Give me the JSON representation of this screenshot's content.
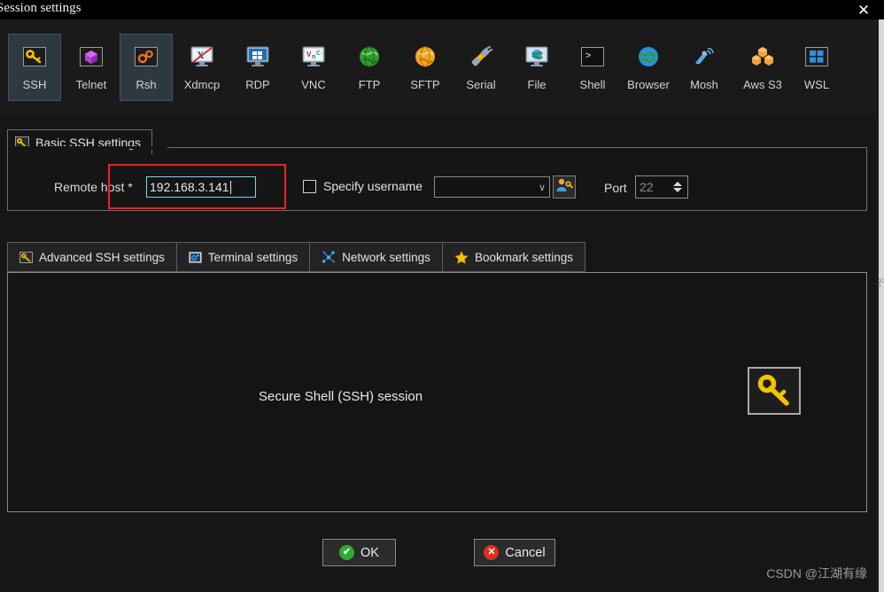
{
  "window": {
    "title": "Session settings",
    "close_label": "✕"
  },
  "session_types": [
    {
      "label": "SSH",
      "icon": "ssh-key-icon",
      "selected": true
    },
    {
      "label": "Telnet",
      "icon": "telnet-cube-icon",
      "selected": false
    },
    {
      "label": "Rsh",
      "icon": "rsh-gears-icon",
      "selected": true
    },
    {
      "label": "Xdmcp",
      "icon": "xdmcp-monitor-icon",
      "selected": false
    },
    {
      "label": "RDP",
      "icon": "rdp-windows-icon",
      "selected": false
    },
    {
      "label": "VNC",
      "icon": "vnc-monitor-icon",
      "selected": false
    },
    {
      "label": "FTP",
      "icon": "ftp-globe-icon",
      "selected": false
    },
    {
      "label": "SFTP",
      "icon": "sftp-globe-icon",
      "selected": false
    },
    {
      "label": "Serial",
      "icon": "serial-plug-icon",
      "selected": false
    },
    {
      "label": "File",
      "icon": "file-monitor-icon",
      "selected": false
    },
    {
      "label": "Shell",
      "icon": "shell-prompt-icon",
      "selected": false
    },
    {
      "label": "Browser",
      "icon": "browser-globe-icon",
      "selected": false
    },
    {
      "label": "Mosh",
      "icon": "mosh-antenna-icon",
      "selected": false
    },
    {
      "label": "Aws S3",
      "icon": "aws-s3-icon",
      "selected": false
    },
    {
      "label": "WSL",
      "icon": "wsl-windows-icon",
      "selected": false
    }
  ],
  "basic_settings": {
    "group_title": "Basic SSH settings",
    "group_icon": "ssh-key-icon",
    "remote_host_label": "Remote host *",
    "remote_host_value": "192.168.3.141",
    "remote_host_placeholder": "",
    "specify_username_label": "Specify username",
    "specify_username_checked": false,
    "username_value": "",
    "username_placeholder": "",
    "username_dropdown_glyph": "∨",
    "userkey_button_icon": "user-key-icon",
    "port_label": "Port",
    "port_value": "22"
  },
  "settings_tabs": [
    {
      "label": "Advanced SSH settings",
      "icon": "ssh-key-icon"
    },
    {
      "label": "Terminal settings",
      "icon": "terminal-icon"
    },
    {
      "label": "Network settings",
      "icon": "network-nodes-icon"
    },
    {
      "label": "Bookmark settings",
      "icon": "star-icon"
    }
  ],
  "pane": {
    "description": "Secure Shell (SSH) session",
    "icon": "ssh-key-large-icon"
  },
  "footer": {
    "ok_label": "OK",
    "ok_badge": "✔",
    "cancel_label": "Cancel",
    "cancel_badge": "✕"
  },
  "watermark": "CSDN @江湖有缘",
  "edge_glyph": "行",
  "colors": {
    "window_bg": "#161616",
    "titlebar_bg": "#000000",
    "selected_tile": "#2e3841",
    "highlight_red": "#ee2222",
    "focus_cyan": "#7fd4e8",
    "ok_green": "#2eab30",
    "cancel_red": "#e02b20",
    "key_yellow": "#f2c300"
  }
}
